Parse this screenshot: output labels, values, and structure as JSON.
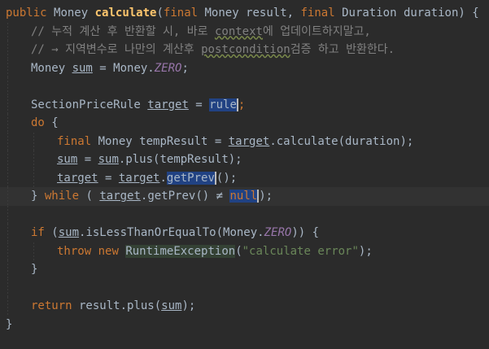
{
  "code": {
    "l1": {
      "kw_public": "public",
      "type_money": "Money",
      "fn_calculate": "calculate",
      "p_open": "(",
      "kw_final1": "final",
      "param1": " Money result, ",
      "kw_final2": "final",
      "param2": " Duration duration) {"
    },
    "l2": {
      "c1": "// 누적 계산 후 반환할 시, 바로 ",
      "c_context": "context",
      "c2": "에 업데이트하지말고,"
    },
    "l3": {
      "c1": "// → 지역변수로 나만의 계산후 ",
      "c_post": "postcondition",
      "c2": "검증 하고 반환한다."
    },
    "l4": {
      "a": "Money ",
      "sum": "sum",
      "b": " = Money.",
      "zero": "ZERO",
      "c": ";"
    },
    "l6": {
      "a": "SectionPriceRule ",
      "target": "target",
      "b": " = ",
      "rule": "rule",
      "c": ";"
    },
    "l7": {
      "kw_do": "do",
      "a": " {"
    },
    "l8": {
      "kw_final": "final",
      "a": " Money tempResult = ",
      "target": "target",
      "b": ".calculate(duration);"
    },
    "l9": {
      "sum1": "sum",
      "a": " = ",
      "sum2": "sum",
      "b": ".plus(tempResult);"
    },
    "l10": {
      "t1": "target",
      "a": " = ",
      "t2": "target",
      "b": ".",
      "getprev": "getPrev",
      "c": "();"
    },
    "l11": {
      "a": "} ",
      "kw_while": "while",
      "b": " ( ",
      "target": "target",
      "c": ".getPrev() ≠ ",
      "null": "null",
      "d": ");"
    },
    "l13": {
      "kw_if": "if",
      "a": " (",
      "sum": "sum",
      "b": ".isLessThanOrEqualTo(Money.",
      "zero": "ZERO",
      "c": ")) {"
    },
    "l14": {
      "kw_throw": "throw",
      "sp": " ",
      "kw_new": "new",
      "sp2": " ",
      "exc": "RuntimeException",
      "a": "(",
      "str": "\"calculate error\"",
      "b": ");"
    },
    "l15": {
      "a": "}"
    },
    "l17": {
      "kw_return": "return",
      "a": " result.plus(",
      "sum": "sum",
      "b": ");"
    },
    "l18": {
      "a": "}"
    }
  }
}
